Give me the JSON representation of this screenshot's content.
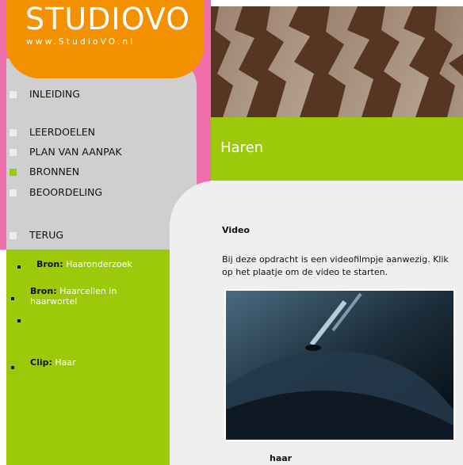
{
  "logo": {
    "name": "STUDIOVO",
    "url": "www.StudioVO.nl"
  },
  "nav": {
    "items": [
      {
        "label": "INLEIDING",
        "active": false
      },
      {
        "label": "LEERDOELEN",
        "active": false
      },
      {
        "label": "PLAN VAN AANPAK",
        "active": false
      },
      {
        "label": "BRONNEN",
        "active": true
      },
      {
        "label": "BEOORDELING",
        "active": false
      },
      {
        "label": "TERUG",
        "active": false
      }
    ]
  },
  "sources": [
    {
      "prefix": "Bron:",
      "text": "Haaronderzoek"
    },
    {
      "prefix": "Bron:",
      "text": "Haarcellen in haarwortel"
    },
    {
      "prefix": "Clip:",
      "text": "Haar"
    }
  ],
  "page": {
    "title": "Haren",
    "section_title": "Video",
    "body": "Bij deze opdracht is een videofilmpje aanwezig. Klik op het plaatje om de video te starten.",
    "video_caption": "haar"
  },
  "colors": {
    "pink": "#ef6fad",
    "orange": "#f39100",
    "green": "#9cca0a",
    "grey": "#cfcfcf"
  }
}
